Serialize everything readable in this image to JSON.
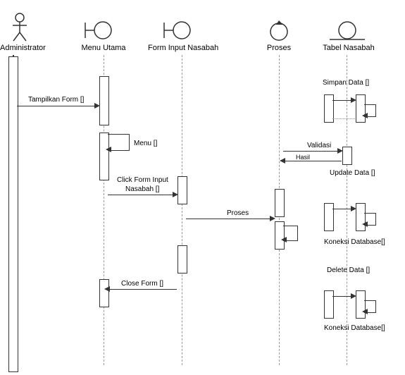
{
  "participants": {
    "administrator": "Administrator",
    "menu_utama": "Menu Utama",
    "form_input_nasabah": "Form Input Nasabah",
    "proses": "Proses",
    "tabel_nasabah": "Tabel Nasabah"
  },
  "messages": {
    "tampilkan_form": "Tampilkan Form []",
    "menu": "Menu []",
    "click_form_input": "Click Form Input",
    "nasabah_label": "Nasabah  []",
    "proses_msg": "Proses",
    "close_form": "Close Form []",
    "simpan_data": "Simpan Data []",
    "validasi": "Validasi",
    "hasil": "Hasil",
    "update_data": "Update Data []",
    "koneksi_database1": "Koneksi Database[]",
    "delete_data": "Delete Data []",
    "koneksi_database2": "Koneksi Database[]"
  },
  "chart_data": {
    "type": "sequence_diagram",
    "participants": [
      {
        "name": "Administrator",
        "type": "actor"
      },
      {
        "name": "Menu Utama",
        "type": "boundary"
      },
      {
        "name": "Form Input Nasabah",
        "type": "boundary"
      },
      {
        "name": "Proses",
        "type": "control"
      },
      {
        "name": "Tabel Nasabah",
        "type": "entity"
      }
    ],
    "messages": [
      {
        "from": "Administrator",
        "to": "Menu Utama",
        "label": "Tampilkan Form []"
      },
      {
        "from": "Menu Utama",
        "to": "Menu Utama",
        "label": "Menu []",
        "kind": "self"
      },
      {
        "from": "Menu Utama",
        "to": "Form Input Nasabah",
        "label": "Click Form Input Nasabah []"
      },
      {
        "from": "Form Input Nasabah",
        "to": "Proses",
        "label": "Proses"
      },
      {
        "from": "Form Input Nasabah",
        "to": "Menu Utama",
        "label": "Close Form []"
      },
      {
        "from": "Proses",
        "to": "Tabel Nasabah",
        "label": "Simpan Data []"
      },
      {
        "from": "Proses",
        "to": "Tabel Nasabah",
        "label": "Validasi"
      },
      {
        "from": "Tabel Nasabah",
        "to": "Proses",
        "label": "Hasil"
      },
      {
        "from": "Proses",
        "to": "Tabel Nasabah",
        "label": "Update Data []"
      },
      {
        "from": "Proses",
        "to": "Tabel Nasabah",
        "label": "Koneksi Database[]"
      },
      {
        "from": "Proses",
        "to": "Tabel Nasabah",
        "label": "Delete Data []"
      },
      {
        "from": "Proses",
        "to": "Tabel Nasabah",
        "label": "Koneksi Database[]"
      }
    ]
  }
}
